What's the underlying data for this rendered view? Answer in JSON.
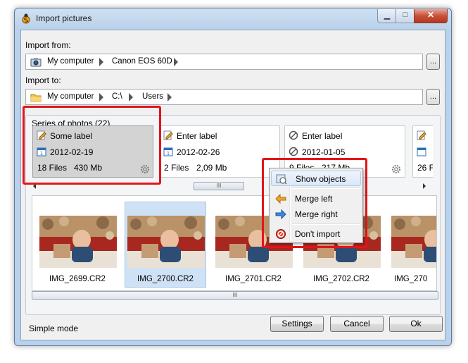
{
  "window": {
    "title": "Import pictures"
  },
  "import_from": {
    "label": "Import from:",
    "crumbs": [
      "My computer",
      "Canon EOS 60D"
    ],
    "browse_label": "..."
  },
  "import_to": {
    "label": "Import to:",
    "crumbs": [
      "My computer",
      "C:\\",
      "Users"
    ],
    "browse_label": "..."
  },
  "series": {
    "title": "Series of photos (22)",
    "cards": [
      {
        "label": "Some label",
        "date": "2012-02-19",
        "files": "18 Files",
        "size": "430 Mb"
      },
      {
        "label": "Enter label",
        "date": "2012-02-26",
        "files": "2 Files",
        "size": "2,09 Mb"
      },
      {
        "label": "Enter label",
        "date": "2012-01-05",
        "files": "9 Files",
        "size": "217 Mb"
      },
      {
        "label": "",
        "date": "",
        "files": "26 F",
        "size": ""
      }
    ],
    "scroll_grip": "III"
  },
  "thumbnails": {
    "items": [
      "IMG_2699.CR2",
      "IMG_2700.CR2",
      "IMG_2701.CR2",
      "IMG_2702.CR2",
      "IMG_270"
    ],
    "scroll_grip": "III"
  },
  "context_menu": {
    "items": [
      "Show objects",
      "Merge left",
      "Merge right",
      "Don't import"
    ]
  },
  "footer": {
    "mode_label": "Simple mode",
    "settings_label": "Settings",
    "cancel_label": "Cancel",
    "ok_label": "Ok"
  },
  "colors": {
    "highlight": "#e2151b",
    "selection": "#cfe2f5"
  }
}
